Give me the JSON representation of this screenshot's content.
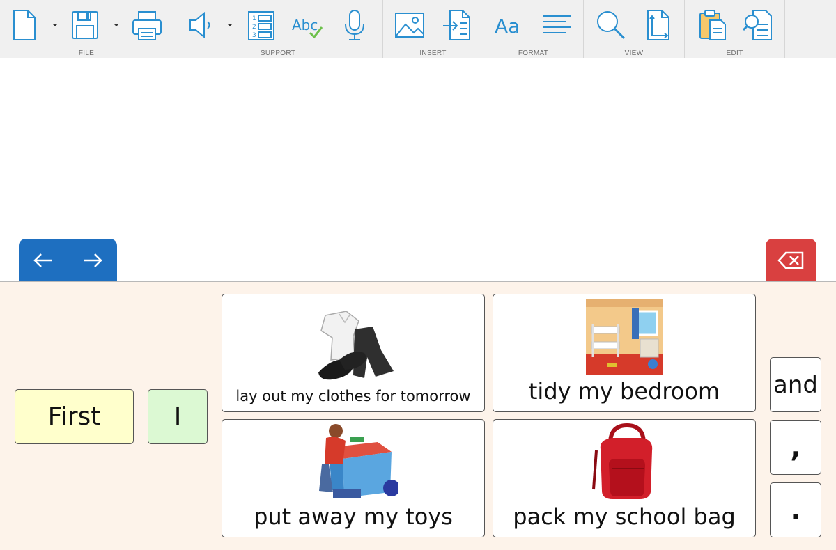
{
  "toolbar": {
    "groups": {
      "file": "FILE",
      "support": "SUPPORT",
      "insert": "INSERT",
      "format": "FORMAT",
      "view": "VIEW",
      "edit": "EDIT"
    },
    "icons": [
      "new-document-icon",
      "save-icon",
      "print-icon",
      "speaker-icon",
      "numbered-list-icon",
      "spellcheck-icon",
      "microphone-icon",
      "insert-image-icon",
      "insert-file-icon",
      "font-icon",
      "align-icon",
      "search-icon",
      "page-size-icon",
      "paste-icon",
      "find-icon"
    ],
    "accent_color": "#2a8fd0"
  },
  "navigation": {
    "left_icon": "arrow-left-icon",
    "right_icon": "arrow-right-icon",
    "color": "#1e6fc0"
  },
  "delete": {
    "icon": "backspace-icon",
    "color": "#d94040"
  },
  "grid": {
    "first": "First",
    "i": "I",
    "phrases": [
      {
        "label": "lay out my clothes for tomorrow",
        "icon": "clothes-icon"
      },
      {
        "label": "tidy my bedroom",
        "icon": "bedroom-icon"
      },
      {
        "label": "put away my toys",
        "icon": "toys-icon"
      },
      {
        "label": "pack my school bag",
        "icon": "school-bag-icon"
      }
    ],
    "connectors": {
      "and": "and",
      "comma": ",",
      "period": "."
    },
    "colors": {
      "first_bg": "#ffffcc",
      "i_bg": "#dcf9d3",
      "panel_bg": "#fdf3ea"
    }
  }
}
